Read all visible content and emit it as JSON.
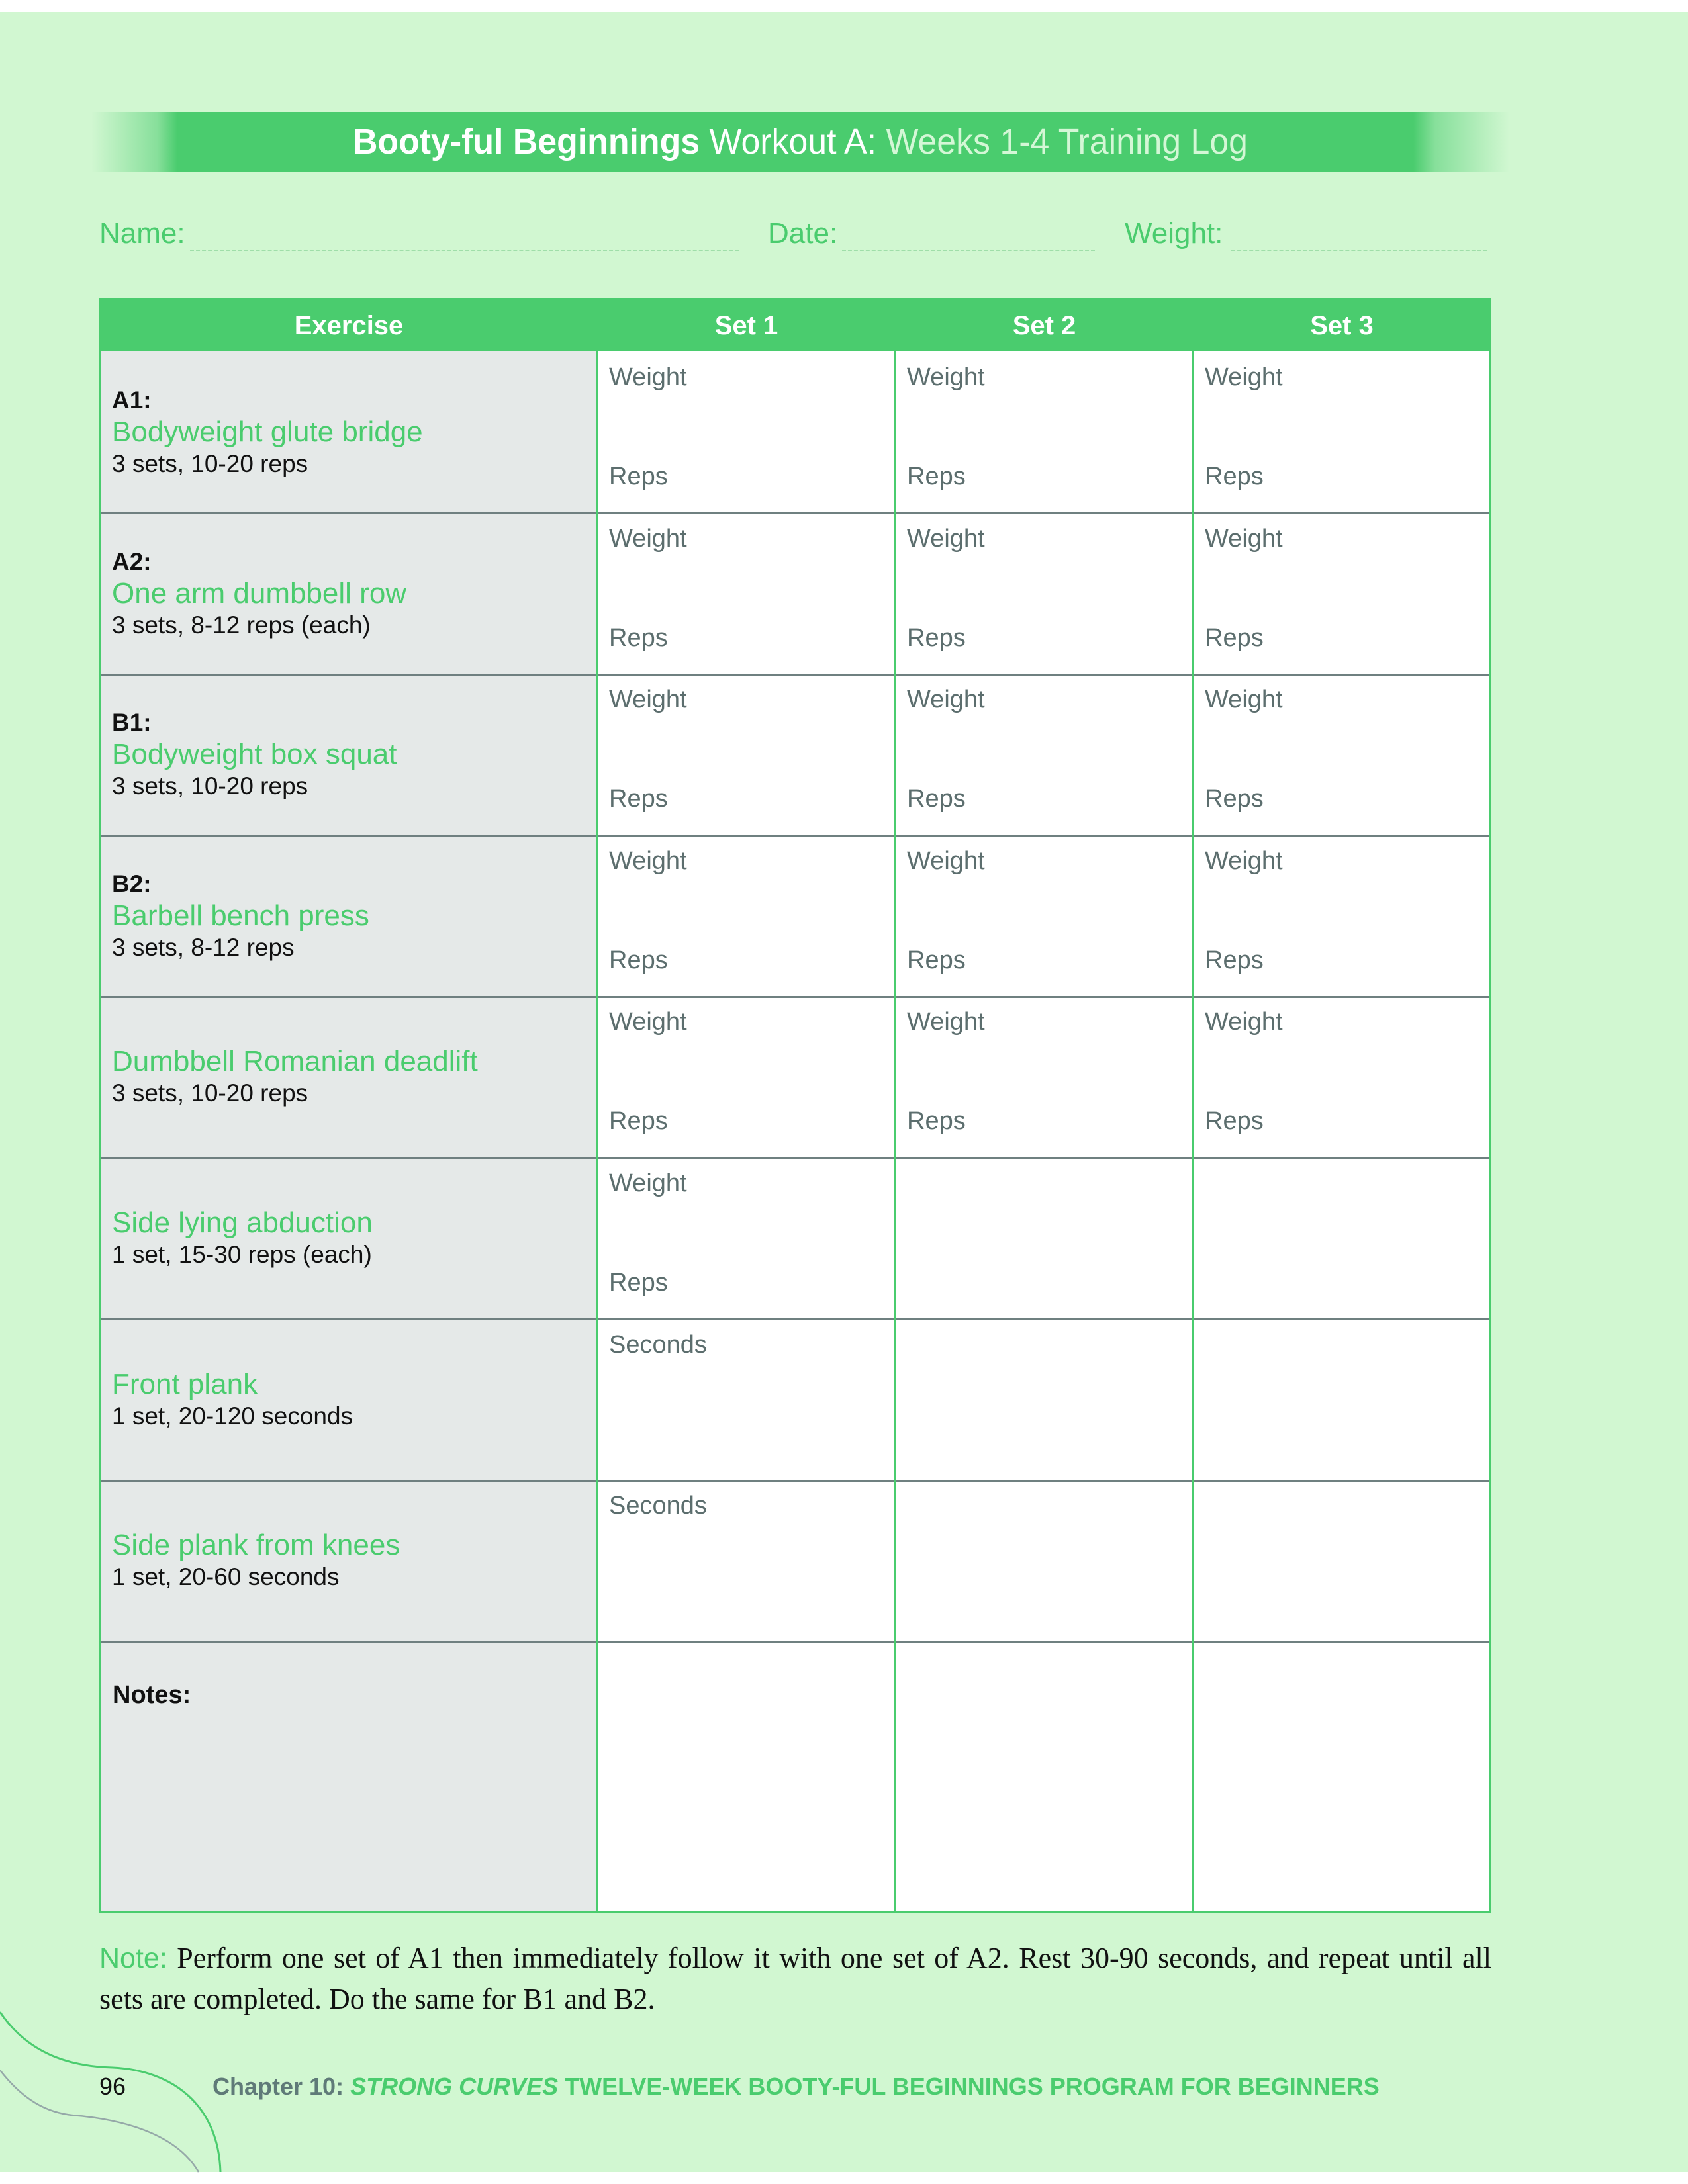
{
  "header": {
    "title_bold": "Booty-ful Beginnings",
    "title_mid": " Workout A: ",
    "title_light": "Weeks 1-4 Training Log"
  },
  "fields": {
    "name_label": "Name:",
    "name_value": "",
    "date_label": "Date:",
    "date_value": "",
    "weight_label": "Weight:",
    "weight_value": ""
  },
  "table": {
    "columns": [
      "Exercise",
      "Set 1",
      "Set 2",
      "Set 3"
    ],
    "rows": [
      {
        "label": "A1:",
        "name": "Bodyweight glute bridge",
        "desc": "3 sets, 10-20 reps",
        "sets": [
          {
            "top": "Weight",
            "bottom": "Reps"
          },
          {
            "top": "Weight",
            "bottom": "Reps"
          },
          {
            "top": "Weight",
            "bottom": "Reps"
          }
        ]
      },
      {
        "label": "A2:",
        "name": "One arm dumbbell row",
        "desc": "3 sets, 8-12 reps (each)",
        "sets": [
          {
            "top": "Weight",
            "bottom": "Reps"
          },
          {
            "top": "Weight",
            "bottom": "Reps"
          },
          {
            "top": "Weight",
            "bottom": "Reps"
          }
        ]
      },
      {
        "label": "B1:",
        "name": "Bodyweight box squat",
        "desc": "3 sets, 10-20 reps",
        "sets": [
          {
            "top": "Weight",
            "bottom": "Reps"
          },
          {
            "top": "Weight",
            "bottom": "Reps"
          },
          {
            "top": "Weight",
            "bottom": "Reps"
          }
        ]
      },
      {
        "label": "B2:",
        "name": "Barbell bench press",
        "desc": "3 sets, 8-12 reps",
        "sets": [
          {
            "top": "Weight",
            "bottom": "Reps"
          },
          {
            "top": "Weight",
            "bottom": "Reps"
          },
          {
            "top": "Weight",
            "bottom": "Reps"
          }
        ]
      },
      {
        "label": "",
        "name": "Dumbbell Romanian deadlift",
        "desc": "3 sets, 10-20 reps",
        "sets": [
          {
            "top": "Weight",
            "bottom": "Reps"
          },
          {
            "top": "Weight",
            "bottom": "Reps"
          },
          {
            "top": "Weight",
            "bottom": "Reps"
          }
        ]
      },
      {
        "label": "",
        "name": "Side lying abduction",
        "desc": "1 set, 15-30 reps (each)",
        "sets": [
          {
            "top": "Weight",
            "bottom": "Reps"
          },
          {
            "top": "",
            "bottom": ""
          },
          {
            "top": "",
            "bottom": ""
          }
        ]
      },
      {
        "label": "",
        "name": "Front plank",
        "desc": "1 set, 20-120 seconds",
        "sets": [
          {
            "top": "Seconds",
            "bottom": ""
          },
          {
            "top": "",
            "bottom": ""
          },
          {
            "top": "",
            "bottom": ""
          }
        ]
      },
      {
        "label": "",
        "name": "Side plank from knees",
        "desc": "1 set, 20-60 seconds",
        "sets": [
          {
            "top": "Seconds",
            "bottom": ""
          },
          {
            "top": "",
            "bottom": ""
          },
          {
            "top": "",
            "bottom": ""
          }
        ]
      }
    ],
    "notes_label": "Notes:"
  },
  "note": {
    "label": "Note:",
    "text": " Perform one set of A1 then immediately follow it with one set of A2. Rest 30-90 seconds, and repeat until all sets are completed. Do the same for B1 and B2."
  },
  "footer": {
    "page_number": "96",
    "chapter": "Chapter 10: ",
    "book_title": "STRONG CURVES",
    "rest": " TWELVE-WEEK BOOTY-FUL BEGINNINGS PROGRAM FOR BEGINNERS"
  },
  "colors": {
    "accent_green": "#4acc6e",
    "page_background": "#d1f7d1",
    "exercise_column_fill": "#e5e9e8",
    "label_gray": "#5c6e6e"
  }
}
